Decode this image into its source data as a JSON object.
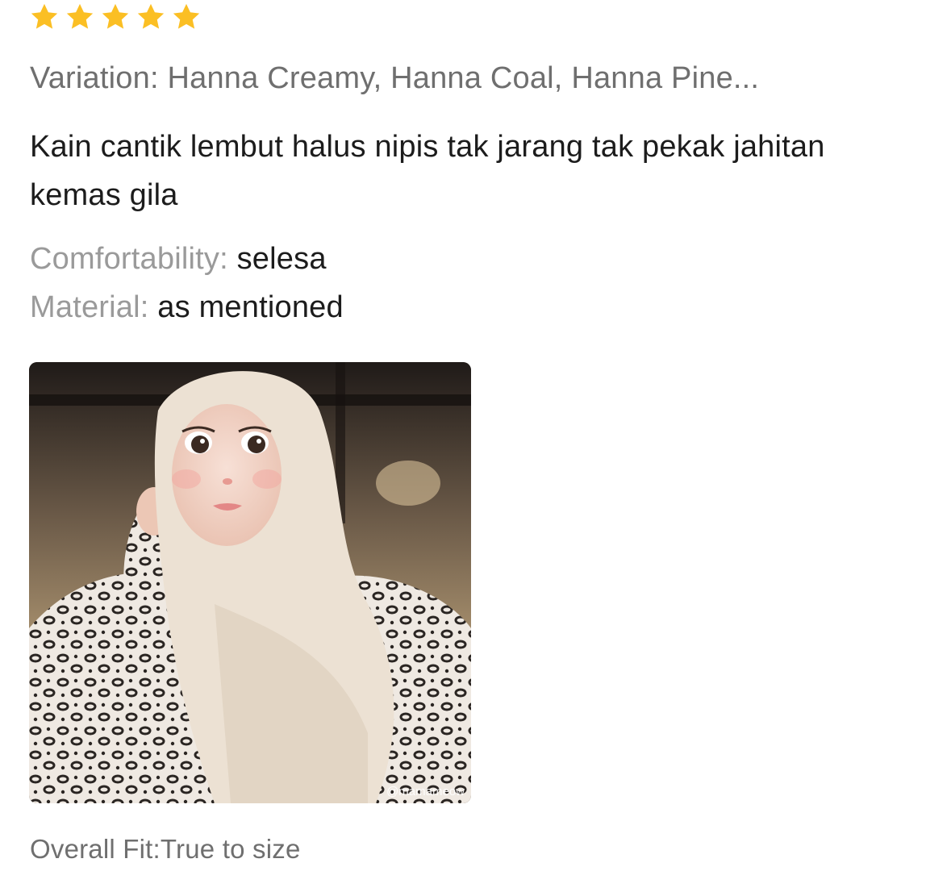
{
  "review": {
    "rating": 5,
    "rating_max": 5,
    "star_color": "#fbbf24",
    "variation": "Variation: Hanna Creamy, Hanna Coal, Hanna Pine...",
    "text": "Kain cantik lembut halus nipis tak jarang tak pekak jahitan kemas gila",
    "attributes": [
      {
        "label": "Comfortability:",
        "value": "selesa"
      },
      {
        "label": "Material:",
        "value": "as mentioned"
      }
    ],
    "photo": {
      "watermark": "@mamameow"
    },
    "overall_fit": "Overall Fit:True to size"
  }
}
